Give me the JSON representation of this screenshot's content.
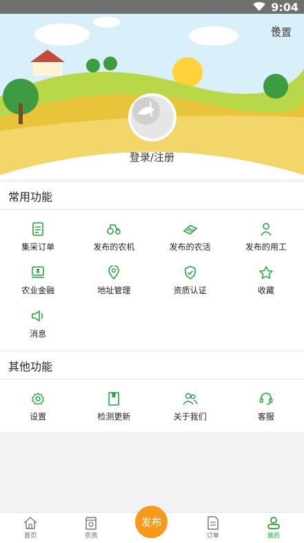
{
  "status_bar": {
    "time": "9:04"
  },
  "header": {
    "settings_label": "设置",
    "login_label": "登录/注册"
  },
  "common": {
    "title": "常用功能",
    "items": [
      {
        "label": "集采订单",
        "icon": "document-icon"
      },
      {
        "label": "发布的农机",
        "icon": "tractor-icon"
      },
      {
        "label": "发布的农活",
        "icon": "field-work-icon"
      },
      {
        "label": "发布的用工",
        "icon": "worker-icon"
      },
      {
        "label": "农业金融",
        "icon": "money-icon"
      },
      {
        "label": "地址管理",
        "icon": "location-icon"
      },
      {
        "label": "资质认证",
        "icon": "shield-check-icon"
      },
      {
        "label": "收藏",
        "icon": "star-icon"
      },
      {
        "label": "消息",
        "icon": "speaker-icon"
      }
    ]
  },
  "other": {
    "title": "其他功能",
    "items": [
      {
        "label": "设置",
        "icon": "gear-icon"
      },
      {
        "label": "检测更新",
        "icon": "bookmark-book-icon"
      },
      {
        "label": "关于我们",
        "icon": "users-icon"
      },
      {
        "label": "客服",
        "icon": "headset-icon"
      }
    ]
  },
  "tabs": [
    {
      "label": "首页",
      "icon": "home-icon"
    },
    {
      "label": "农资",
      "icon": "supplies-icon"
    },
    {
      "label": "订单",
      "icon": "order-icon"
    },
    {
      "label": "我的",
      "icon": "profile-icon",
      "active": true
    }
  ],
  "publish_label": "发布",
  "colors": {
    "accent_green": "#24a33a",
    "publish_orange": "#f79a1c"
  }
}
